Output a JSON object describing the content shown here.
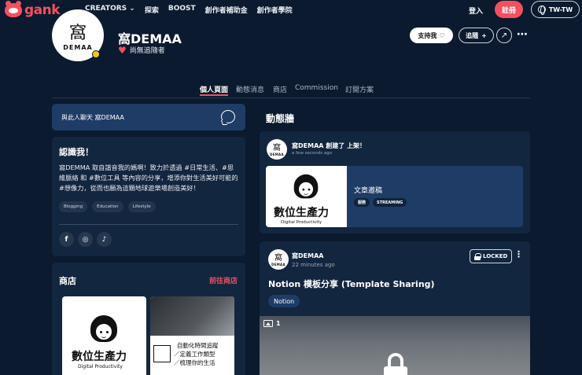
{
  "nav": {
    "logo_text": "gank",
    "links": [
      "CREATORS",
      "探索",
      "BOOST",
      "創作者補助金",
      "創作者學院"
    ],
    "login": "登入",
    "signup": "註冊",
    "language": "TW-TW"
  },
  "creator": {
    "avatar_big": "窩",
    "avatar_small": "DEMAA",
    "name": "窩DEMAA",
    "followers_text": "尚無追隨者",
    "support_label": "支持我",
    "follow_label": "追隨"
  },
  "tabs": [
    "個人頁面",
    "動態消息",
    "商店",
    "Commission",
    "訂閱方案"
  ],
  "chat": {
    "label": "與此人聊天 窩DEMAA"
  },
  "about": {
    "title": "認識我！",
    "text": "窩DEMMA 取自諧音我的媽啊！致力於透過 #日常生活、#思維脈絡 和 #數位工具 等內容的分享，增添你對生活美好可能的 #想像力，從而也願為這顆地球遊樂場創造美好！",
    "tags": [
      "Blogging",
      "Education",
      "Lifestyle"
    ],
    "socials": [
      "f",
      "◎",
      "♪"
    ]
  },
  "shop": {
    "title": "商店",
    "link": "前往商店",
    "product1": {
      "title": "數位生產力",
      "subtitle": "Digital Productivity"
    },
    "product2": {
      "line1": "自動化時間追蹤",
      "line2": "／定義工作類型",
      "line3": "／梳理你的生活"
    }
  },
  "feed": {
    "heading": "動態牆",
    "post1": {
      "author_line": "窩DEMAA 創建了 上架！",
      "time": "a few seconds ago",
      "thumb_title": "數位生產力",
      "thumb_subtitle": "Digital Productivity",
      "caption": "文章邀稿",
      "tags": [
        "服務",
        "STREAMING"
      ]
    },
    "post2": {
      "author": "窩DEMAA",
      "time": "22 minutes ago",
      "locked": "LOCKED",
      "title": "Notion 模板分享 (Template Sharing)",
      "tag": "Notion",
      "image_count": "1"
    }
  },
  "colors": {
    "accent": "#f3505f",
    "background": "#0b1a2e",
    "card": "#13263f",
    "highlight": "#1e3c66"
  }
}
